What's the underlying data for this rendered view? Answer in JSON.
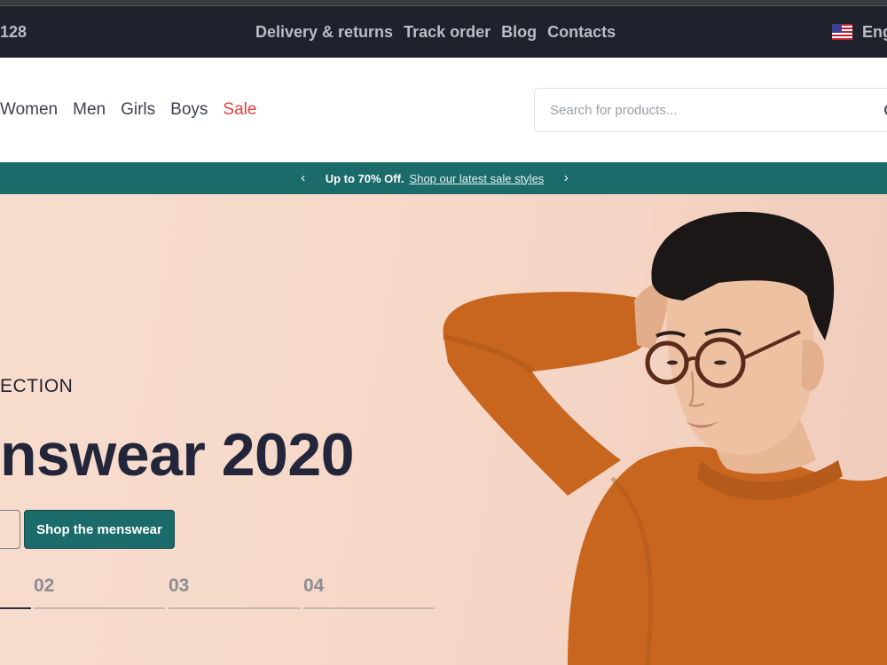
{
  "topbar": {
    "phone": "128",
    "links": [
      "Delivery & returns",
      "Track order",
      "Blog",
      "Contacts"
    ],
    "language": "Eng",
    "flag_icon": "us-flag-icon"
  },
  "nav": {
    "categories": [
      "Women",
      "Men",
      "Girls",
      "Boys"
    ],
    "sale": "Sale",
    "search_placeholder": "Search for products..."
  },
  "promo": {
    "bold": "Up to 70% Off.",
    "link": "Shop our latest sale styles"
  },
  "hero": {
    "eyebrow": "ECTION",
    "headline": "nswear 2020",
    "primary_button": "Shop the menswear",
    "slides": [
      "02",
      "03",
      "04"
    ]
  },
  "colors": {
    "topbar_bg": "#1f222c",
    "accent_teal": "#1c6b6b",
    "sale_red": "#e0403f",
    "hero_bg": "#f6d8c8",
    "sweater": "#c8661f"
  }
}
